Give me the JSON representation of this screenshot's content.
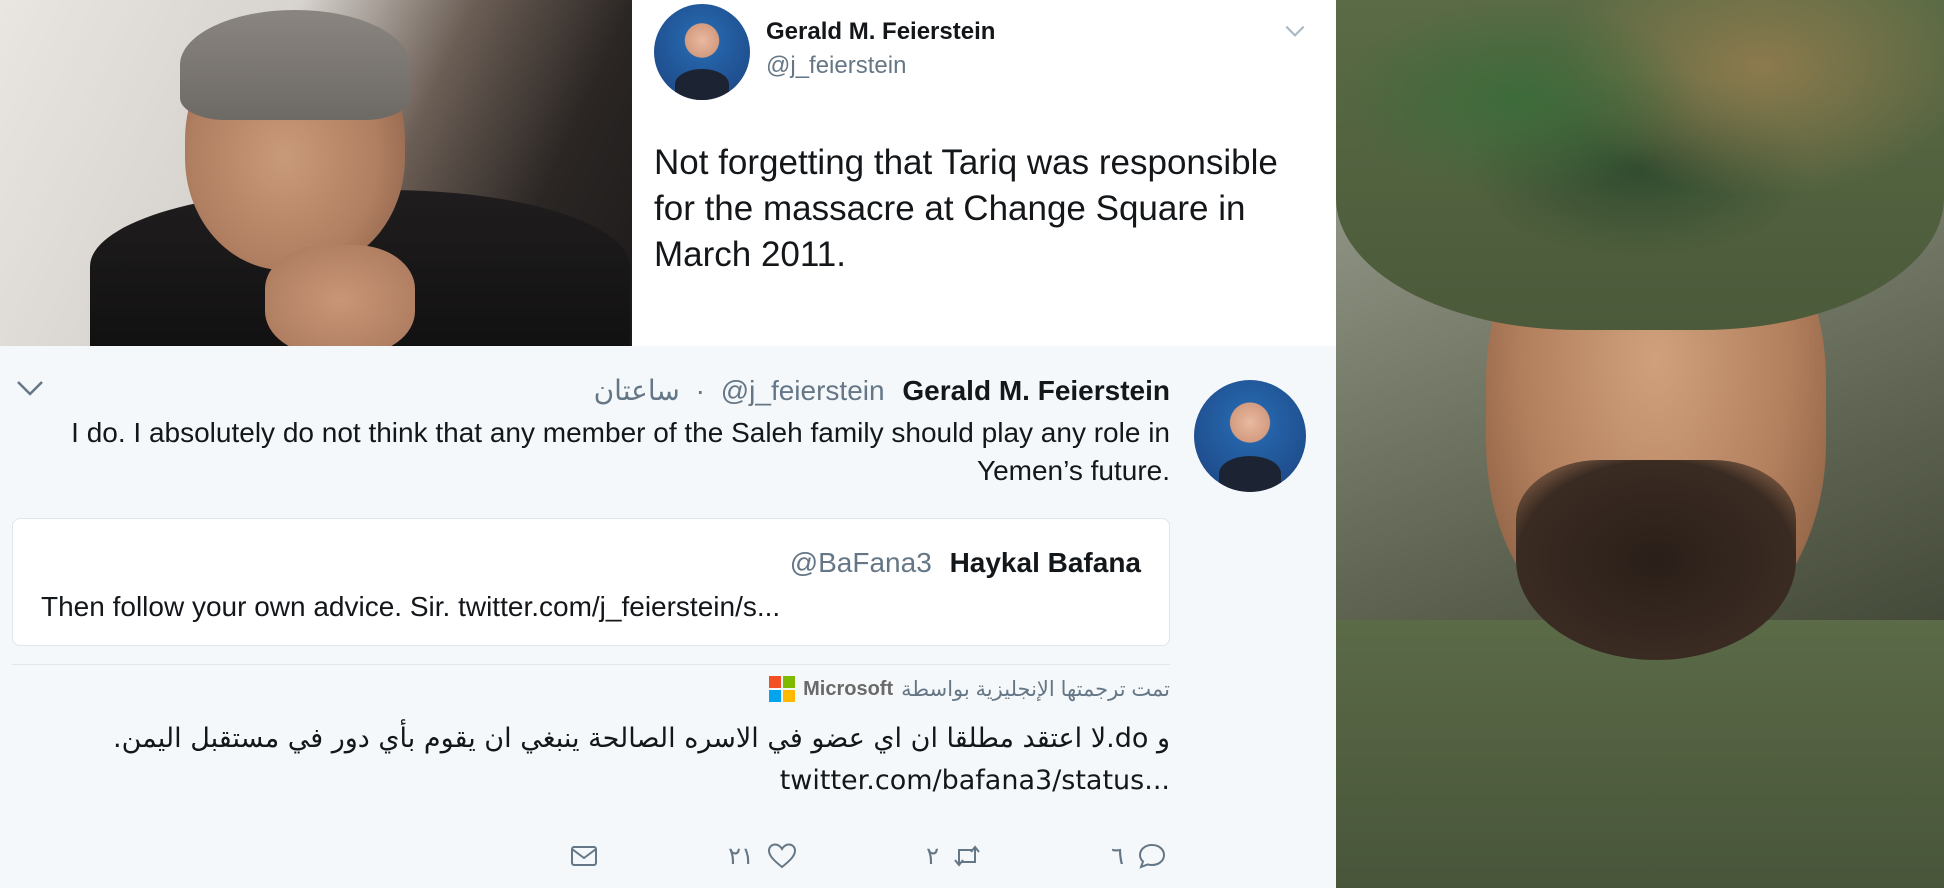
{
  "top_tweet": {
    "author_name": "Gerald M. Feierstein",
    "author_handle": "@j_feierstein",
    "text": "Not forgetting that Tariq was responsible for the massacre at Change Square in March 2011."
  },
  "reply_tweet": {
    "time": "ساعتان",
    "separator": "·",
    "author_handle": "@j_feierstein",
    "author_name": "Gerald M. Feierstein",
    "text": "I do. I absolutely do not think that any member of the Saleh family should play any role in Yemen’s future.",
    "quoted": {
      "handle": "@BaFana3",
      "name": "Haykal Bafana",
      "text": "Then follow your own advice. Sir. twitter.com/j_feierstein/s..."
    },
    "translated_by_label": "تمت ترجمتها الإنجليزية بواسطة",
    "translator_brand": "Microsoft",
    "translation_text": "و do.لا اعتقد مطلقا ان اي عضو في الاسره الصالحة ينبغي ان يقوم بأي دور في مستقبل اليمن. ...twitter.com/bafana3/status",
    "actions": {
      "reply_count": "٦",
      "retweet_count": "٢",
      "like_count": "٢١"
    }
  },
  "icons": [
    "chevron-down-icon",
    "reply-icon",
    "retweet-icon",
    "like-icon",
    "message-icon",
    "microsoft-logo-icon"
  ],
  "colors": {
    "text_primary": "#14171a",
    "text_secondary": "#657786",
    "tweet_background": "#f5f8fa",
    "border": "#e1e8ed"
  }
}
